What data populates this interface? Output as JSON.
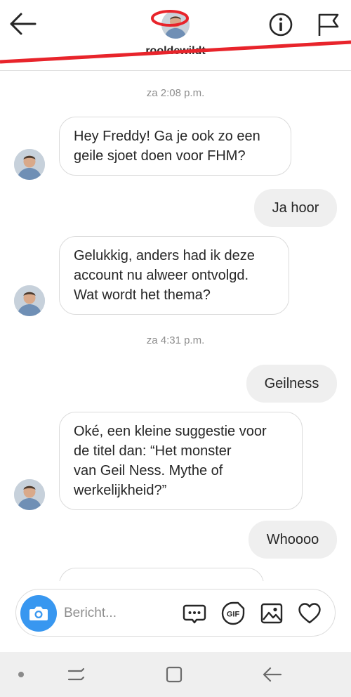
{
  "header": {
    "username": "rooldewildt",
    "icons": {
      "back": "arrow-left-icon",
      "info": "info-icon",
      "report": "flag-icon"
    }
  },
  "messages": {
    "timestamp_1": "za 2:08 p.m.",
    "msg_1": {
      "line_1": "Hey Freddy! Ga je ook zo een",
      "line_2": "geile sjoet doen voor FHM?"
    },
    "msg_2": "Ja hoor",
    "msg_3": {
      "line_1": "Gelukkig, anders had ik deze",
      "line_2": "account nu alweer ontvolgd.",
      "line_3": "Wat wordt het thema?"
    },
    "timestamp_2": "za 4:31 p.m.",
    "msg_4": "Geilness",
    "msg_5": {
      "line_1": "Oké, een kleine suggestie voor",
      "line_2": "de titel dan: “Het monster",
      "line_3": "van Geil Ness. Mythe of",
      "line_4": "werkelijkheid?”"
    },
    "msg_6": "Whoooo"
  },
  "composer": {
    "placeholder": "Bericht...",
    "gif_label": "GIF",
    "icons": {
      "camera": "camera-icon",
      "more": "chat-dots-icon",
      "gif": "gif-icon",
      "gallery": "image-icon",
      "like": "heart-icon"
    }
  },
  "colors": {
    "accent": "#3897f0",
    "redaction": "#e8242b",
    "bubble_out": "#efefef",
    "border": "#dbdbdb"
  }
}
